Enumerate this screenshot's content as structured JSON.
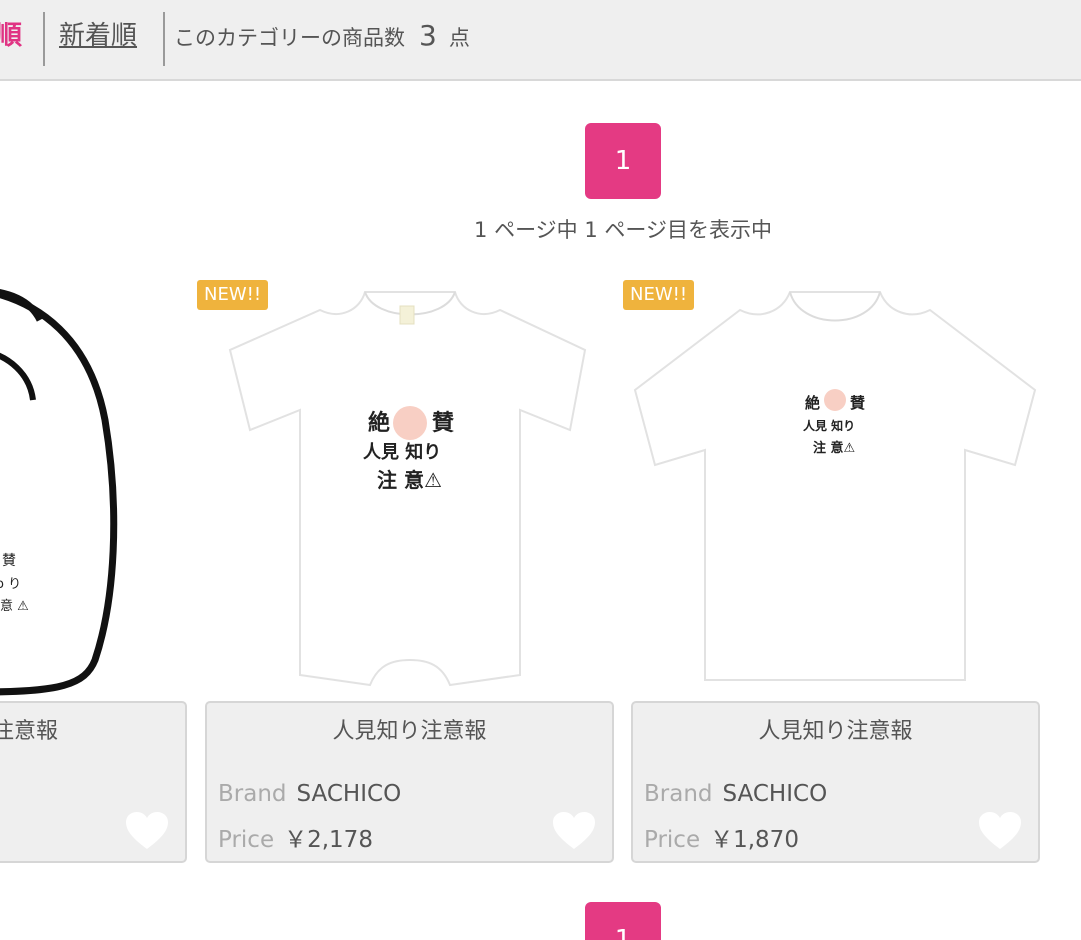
{
  "sort": {
    "active_label": "順",
    "new_label": "新着順",
    "count_prefix": "このカテゴリーの商品数",
    "count_value": "3",
    "count_suffix": "点"
  },
  "pager": {
    "current": "1",
    "info": "1 ページ中 1 ページ目を表示中"
  },
  "products": [
    {
      "name": "注意報",
      "brand_label": "Brand",
      "brand": "",
      "price_label": "Price",
      "price": "",
      "badge": ""
    },
    {
      "name": "人見知り注意報",
      "brand_label": "Brand",
      "brand": "SACHICO",
      "price_label": "Price",
      "price": "￥2,178",
      "badge": "NEW!!"
    },
    {
      "name": "人見知り注意報",
      "brand_label": "Brand",
      "brand": "SACHICO",
      "price_label": "Price",
      "price": "￥1,870",
      "badge": "NEW!!"
    }
  ],
  "colors": {
    "accent": "#e43a83",
    "badge": "#efb33d",
    "card_bg": "#efefef"
  }
}
